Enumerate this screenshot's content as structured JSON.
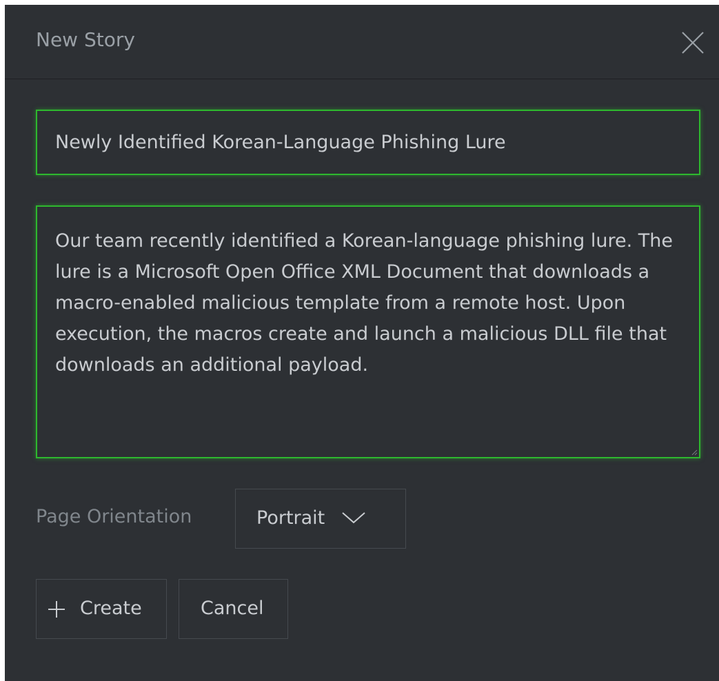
{
  "dialog": {
    "title": "New Story",
    "close_icon": "close-icon"
  },
  "form": {
    "title_value": "Newly Identified Korean-Language Phishing Lure",
    "description_value": "Our team recently identified a Korean-language phishing lure. The lure is a Microsoft Open Office XML Document that downloads a macro-enabled malicious template from a remote host. Upon execution, the macros create and launch a malicious DLL file that downloads an additional payload.",
    "orientation_label": "Page Orientation",
    "orientation_value": "Portrait",
    "orientation_icon": "chevron-down-icon"
  },
  "actions": {
    "create_label": "Create",
    "create_icon": "plus-icon",
    "cancel_label": "Cancel"
  },
  "colors": {
    "background": "#2d3034",
    "focus_border": "#2eb82e",
    "text": "#c9ccd0",
    "muted_text": "#9aa0a6"
  }
}
